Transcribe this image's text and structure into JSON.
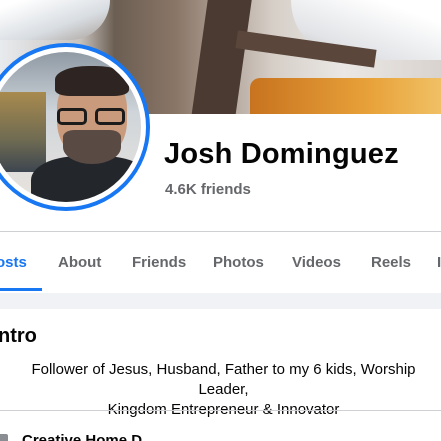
{
  "profile": {
    "name": "Josh Dominguez",
    "friends": "4.6K friends"
  },
  "tabs": [
    {
      "label": "osts",
      "active": true
    },
    {
      "label": "About"
    },
    {
      "label": "Friends"
    },
    {
      "label": "Photos"
    },
    {
      "label": "Videos"
    },
    {
      "label": "Reels"
    },
    {
      "label": "I"
    }
  ],
  "intro": {
    "title": "ntro",
    "bio_line1": "Follower of Jesus, Husband, Father to my 6 kids, Worship Leader,",
    "bio_line2": "Kingdom Entrepreneur & Innovator",
    "work_prefix": "",
    "work_bold": "Creative Home D"
  },
  "colors": {
    "accent": "#1877f2",
    "secondary_text": "#65676b",
    "primary_text": "#050505"
  }
}
